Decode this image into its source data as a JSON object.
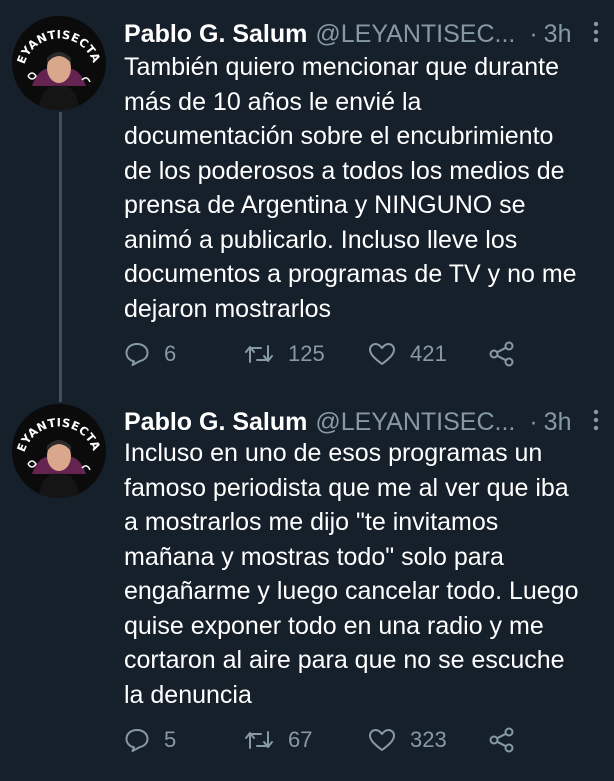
{
  "tweets": [
    {
      "avatar_logo_text": "LEYANTISECTAS",
      "author_name": "Pablo G. Salum",
      "handle": "@LEYANTISEC...",
      "separator": "·",
      "time": "3h",
      "lines": [
        "También quiero mencionar que durante",
        "más de 10 años le envié la",
        "documentación sobre el encubrimiento",
        "de los poderosos a todos los medios de",
        "prensa de Argentina y NINGUNO se",
        "animó a publicarlo. Incluso lleve los",
        "documentos a programas de TV y no me",
        "dejaron mostrarlos"
      ],
      "replies": "6",
      "retweets": "125",
      "likes": "421"
    },
    {
      "avatar_logo_text": "LEYANTISECTAS",
      "author_name": "Pablo G. Salum",
      "handle": "@LEYANTISEC...",
      "separator": "·",
      "time": "3h",
      "lines": [
        "Incluso en uno de esos programas un",
        "famoso periodista que me al ver que iba",
        "a mostrarlos me dijo \"te invitamos",
        "mañana y mostras todo\" solo para",
        "engañarme y luego cancelar todo. Luego",
        "quise exponer todo en una radio y me",
        "cortaron al aire para que no se escuche",
        "la denuncia"
      ],
      "replies": "5",
      "retweets": "67",
      "likes": "323"
    }
  ],
  "icons": {
    "reply": "reply-icon",
    "retweet": "retweet-icon",
    "like": "heart-icon",
    "share": "share-icon",
    "more": "more-vertical-icon"
  },
  "colors": {
    "background": "#15202b",
    "text": "#ffffff",
    "secondary": "#8899a6",
    "thread_line": "#3d4f60"
  }
}
